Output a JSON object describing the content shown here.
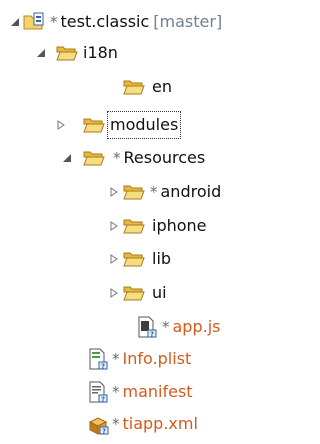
{
  "tree": {
    "project": {
      "label": "test.classic",
      "branch": "[master]",
      "dirty_marker": "*",
      "icon": "project-folder-icon"
    },
    "rows": {
      "i18n": {
        "label": "i18n",
        "icon": "folder-open-icon"
      },
      "en": {
        "label": "en",
        "icon": "folder-open-icon"
      },
      "modules": {
        "label": "modules",
        "icon": "folder-icon"
      },
      "resources": {
        "label": "Resources",
        "dirty_marker": "*",
        "icon": "folder-open-icon"
      },
      "android": {
        "label": "android",
        "dirty_marker": "*",
        "icon": "folder-icon"
      },
      "iphone": {
        "label": "iphone",
        "icon": "folder-icon"
      },
      "lib": {
        "label": "lib",
        "icon": "folder-icon"
      },
      "ui": {
        "label": "ui",
        "icon": "folder-icon"
      },
      "appjs": {
        "label": "app.js",
        "dirty_marker": "*",
        "icon": "js-file-icon"
      },
      "infoplist": {
        "label": "Info.plist",
        "dirty_marker": "*",
        "icon": "plist-file-icon"
      },
      "manifest": {
        "label": "manifest",
        "dirty_marker": "*",
        "icon": "text-file-icon"
      },
      "tiapp": {
        "label": "tiapp.xml",
        "dirty_marker": "*",
        "icon": "xml-file-icon"
      }
    }
  },
  "colors": {
    "changed_text": "#d45a1c",
    "branch_text": "#6f7f96",
    "folder": "#f2cf62",
    "expander": "#555555"
  }
}
